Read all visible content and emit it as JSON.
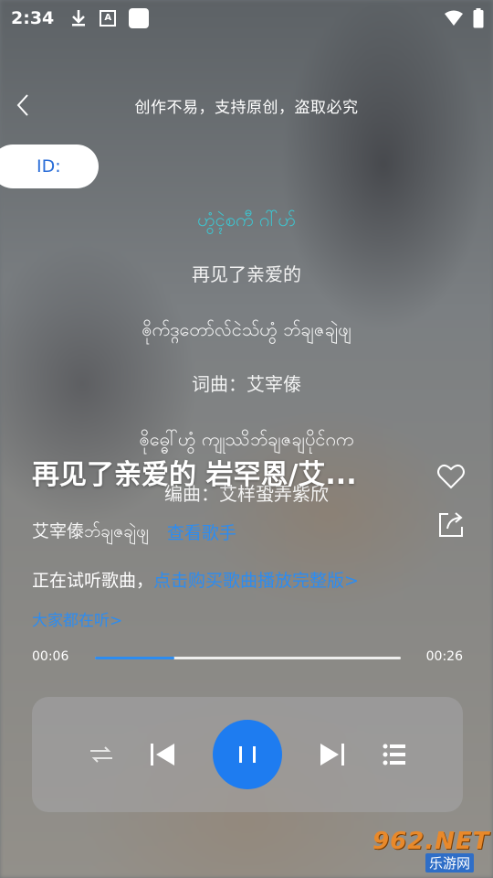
{
  "status_bar": {
    "time": "2:34"
  },
  "header": {
    "title": "创作不易，支持原创，盗取必究"
  },
  "id_pill": {
    "label": "ID:"
  },
  "lyrics": [
    {
      "text": "ဟွံၚဲစကီ ဂါ်ဟ်",
      "active": true
    },
    {
      "text": "再见了亲爱的",
      "active": false
    },
    {
      "text": "ၜိုက်ဒ္ဂတော်လ်ငဲသ်ဟွံ ဘ်ချဇချဲဖျ",
      "active": false
    },
    {
      "text": "词曲：艾宰傣",
      "active": false
    },
    {
      "text": "ၜိုဓ္ဓေါ်ဟွံ ကျုဿိဘ်ချဇချပိုင်ဂက",
      "active": false
    },
    {
      "text": "编曲：艾样蛩弄紫欣",
      "active": false
    }
  ],
  "song": {
    "title": "再见了亲爱的 岩罕恩/艾...",
    "artist": "艾宰傣ဘ်ချဇချဲဖျ",
    "view_singer": "查看歌手",
    "trial_prefix": "正在试听歌曲，",
    "trial_link": "点击购买歌曲播放完整版>",
    "everyone_listening": "大家都在听>"
  },
  "progress": {
    "current": "00:06",
    "total": "00:26",
    "fraction": 0.26
  },
  "colors": {
    "accent": "#2d8cf0",
    "play_button": "#1e7cf0",
    "active_lyric": "#3ec4cf"
  },
  "icons": [
    "download-icon",
    "a-badge-icon",
    "square-icon",
    "wifi-icon",
    "battery-icon",
    "back-icon",
    "heart-icon",
    "share-icon",
    "shuffle-icon",
    "prev-icon",
    "pause-icon",
    "next-icon",
    "playlist-icon"
  ],
  "watermark": {
    "top": "962.NET",
    "bottom": "乐游网"
  }
}
